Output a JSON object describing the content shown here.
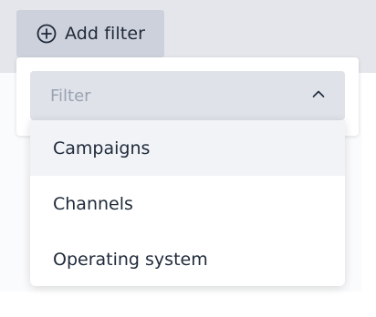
{
  "toolbar": {
    "add_filter_label": "Add filter",
    "add_filter_icon": "plus-circle-icon"
  },
  "filter": {
    "placeholder": "Filter",
    "toggle_icon": "chevron-up-icon",
    "options": [
      {
        "label": "Campaigns"
      },
      {
        "label": "Channels"
      },
      {
        "label": "Operating system"
      }
    ],
    "highlighted_option": "Campaigns"
  },
  "colors": {
    "toolbar_background": "#e4e6ec",
    "button_background": "#cdd1db",
    "select_background": "#dfe2e9",
    "highlight": "#f1f3f7",
    "text": "#1f2a3a",
    "placeholder": "#9aa2b1"
  }
}
